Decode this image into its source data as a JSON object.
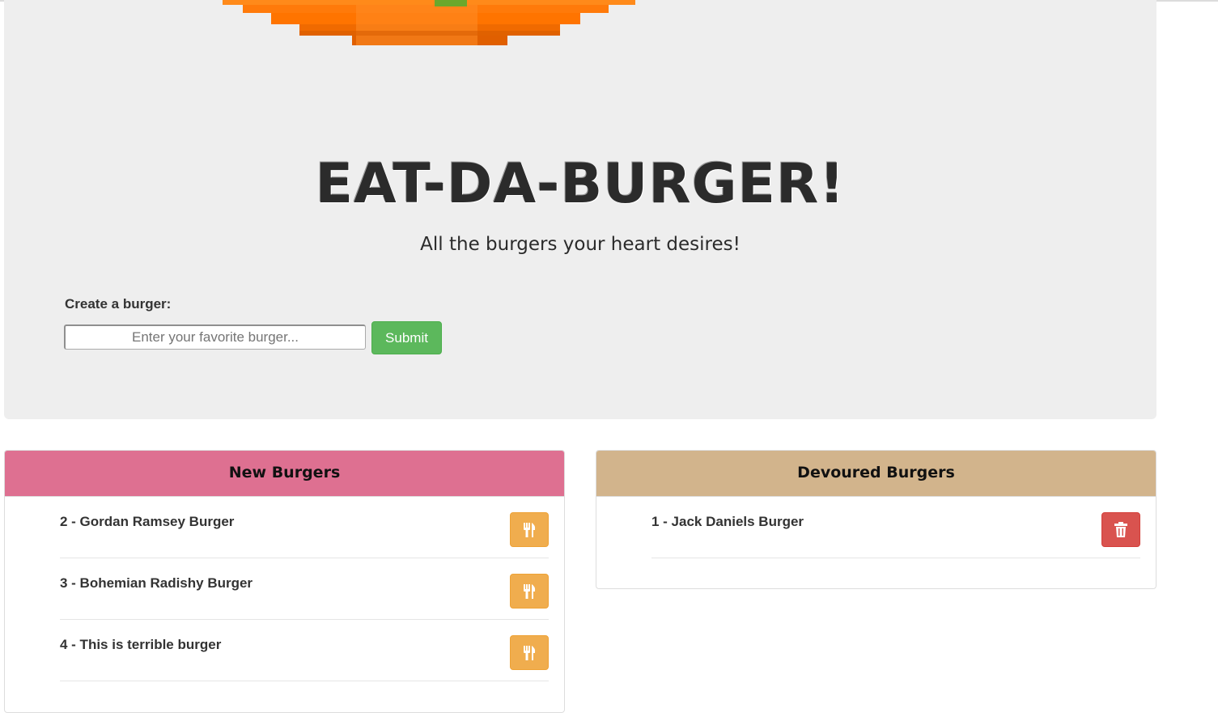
{
  "header": {
    "title": "EAT-DA-BURGER!",
    "subtitle": "All the burgers your heart desires!",
    "logo_icon": "pixel-burger-icon",
    "bg_color": "#eeeeee"
  },
  "form": {
    "label": "Create a burger:",
    "input_placeholder": "Enter your favorite burger...",
    "input_value": "",
    "submit_label": "Submit",
    "submit_color": "#5cb85c"
  },
  "new_burgers": {
    "heading": "New Burgers",
    "heading_color": "#de7091",
    "action_icon": "fork-knife-icon",
    "action_color": "#f0ad4e",
    "items": [
      {
        "label": "2 - Gordan Ramsey Burger"
      },
      {
        "label": "3 - Bohemian Radishy Burger"
      },
      {
        "label": "4 - This is terrible burger"
      }
    ]
  },
  "devoured_burgers": {
    "heading": "Devoured Burgers",
    "heading_color": "#d2b48c",
    "action_icon": "trash-icon",
    "action_color": "#d9534f",
    "items": [
      {
        "label": "1 - Jack Daniels Burger"
      }
    ]
  }
}
